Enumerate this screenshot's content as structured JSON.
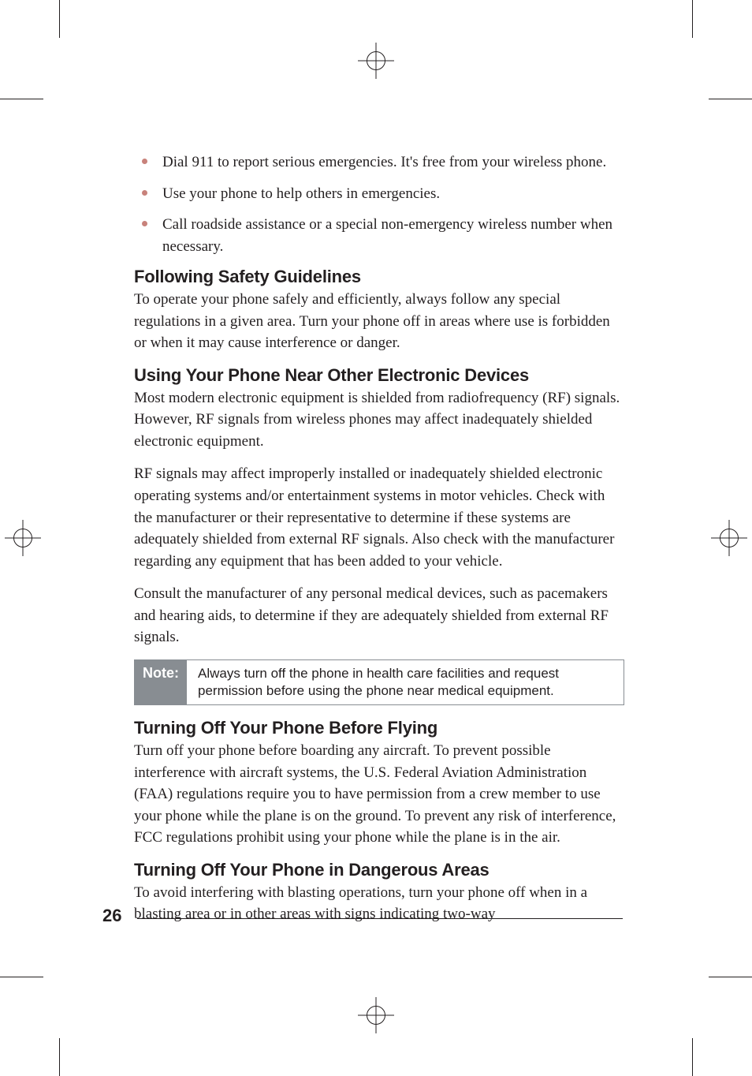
{
  "bullets": [
    "Dial 911 to report serious emergencies. It's free from your wireless phone.",
    "Use your phone to help others in emergencies.",
    "Call roadside assistance or a special non-emergency wireless number when necessary."
  ],
  "sections": {
    "following_guidelines": {
      "heading": "Following Safety Guidelines",
      "body": "To operate your phone safely and efficiently, always follow any special regulations in a given area. Turn your phone off in areas where use is forbidden or when it may cause interference or danger."
    },
    "near_electronics": {
      "heading": "Using Your Phone Near Other Electronic Devices",
      "body1": "Most modern electronic equipment is shielded from radiofrequency (RF) signals. However, RF signals from wireless phones may affect inadequately shielded electronic equipment.",
      "body2": "RF signals may affect improperly installed or inadequately shielded electronic operating systems and/or entertainment systems in motor vehicles. Check with the manufacturer or their representative to determine if these systems are adequately shielded from external RF signals. Also check with the manufacturer regarding any equipment that has been added to your vehicle.",
      "body3": "Consult the manufacturer of any personal medical devices, such as pacemakers and hearing aids, to determine if they are adequately shielded from external RF signals."
    },
    "note": {
      "label": "Note:",
      "text": "Always turn off the phone in health care facilities and request permission before using the phone near medical equipment."
    },
    "flying": {
      "heading": "Turning Off Your Phone Before Flying",
      "body": "Turn off your phone before boarding any aircraft. To prevent possible interference with aircraft systems, the U.S. Federal Aviation Administration (FAA) regulations require you to have permission from a crew member to use your phone while the plane is on the ground. To prevent any risk of interference, FCC regulations prohibit using your phone while the plane is in the air."
    },
    "dangerous": {
      "heading": "Turning Off Your Phone in Dangerous Areas",
      "body": "To avoid interfering with blasting operations, turn your phone off when in a blasting area or in other areas with signs indicating two-way"
    }
  },
  "page_number": "26"
}
